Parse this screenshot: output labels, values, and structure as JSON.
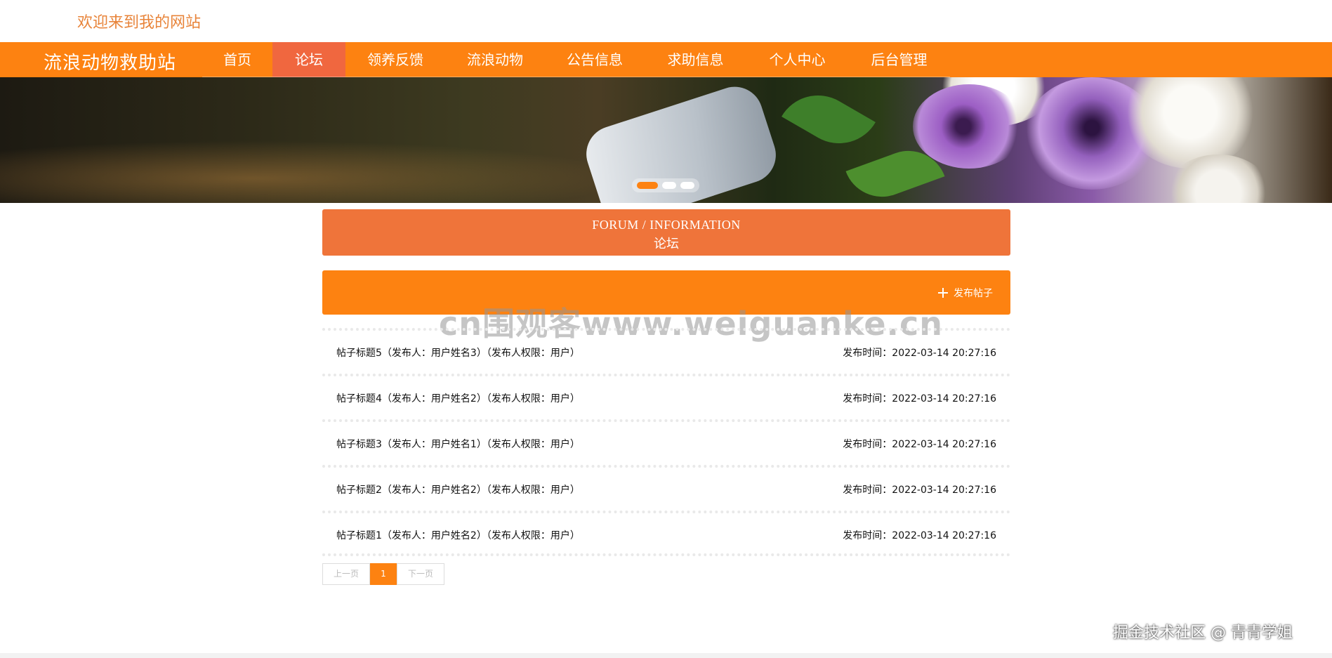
{
  "topbar": {
    "welcome": "欢迎来到我的网站"
  },
  "navbar": {
    "brand": "流浪动物救助站",
    "items": [
      {
        "label": "首页"
      },
      {
        "label": "论坛"
      },
      {
        "label": "领养反馈"
      },
      {
        "label": "流浪动物"
      },
      {
        "label": "公告信息"
      },
      {
        "label": "求助信息"
      },
      {
        "label": "个人中心"
      },
      {
        "label": "后台管理"
      }
    ],
    "active_index": 1,
    "color": "#fd8211",
    "active_color": "#f0673f"
  },
  "banner": {
    "slides": 3,
    "active_slide": 0
  },
  "section": {
    "title_en": "FORUM / INFORMATION",
    "title_cn": "论坛"
  },
  "toolbar": {
    "add_label": "发布帖子",
    "icon": "plus-icon"
  },
  "watermark": "cn围观客www.weiguanke.cn",
  "posts": [
    {
      "title": "帖子标题5（发布人：用户姓名3）（发布人权限：用户）",
      "time": "发布时间：2022-03-14 20:27:16"
    },
    {
      "title": "帖子标题4（发布人：用户姓名2）（发布人权限：用户）",
      "time": "发布时间：2022-03-14 20:27:16"
    },
    {
      "title": "帖子标题3（发布人：用户姓名1）（发布人权限：用户）",
      "time": "发布时间：2022-03-14 20:27:16"
    },
    {
      "title": "帖子标题2（发布人：用户姓名2）（发布人权限：用户）",
      "time": "发布时间：2022-03-14 20:27:16"
    },
    {
      "title": "帖子标题1（发布人：用户姓名2）（发布人权限：用户）",
      "time": "发布时间：2022-03-14 20:27:16"
    }
  ],
  "pager": {
    "prev": "上一页",
    "current": "1",
    "next": "下一页"
  },
  "credit": "掘金技术社区 @ 青青学姐",
  "colors": {
    "accent": "#fd8211",
    "header_accent": "#ef743a",
    "welcome_text": "#e8843a"
  }
}
